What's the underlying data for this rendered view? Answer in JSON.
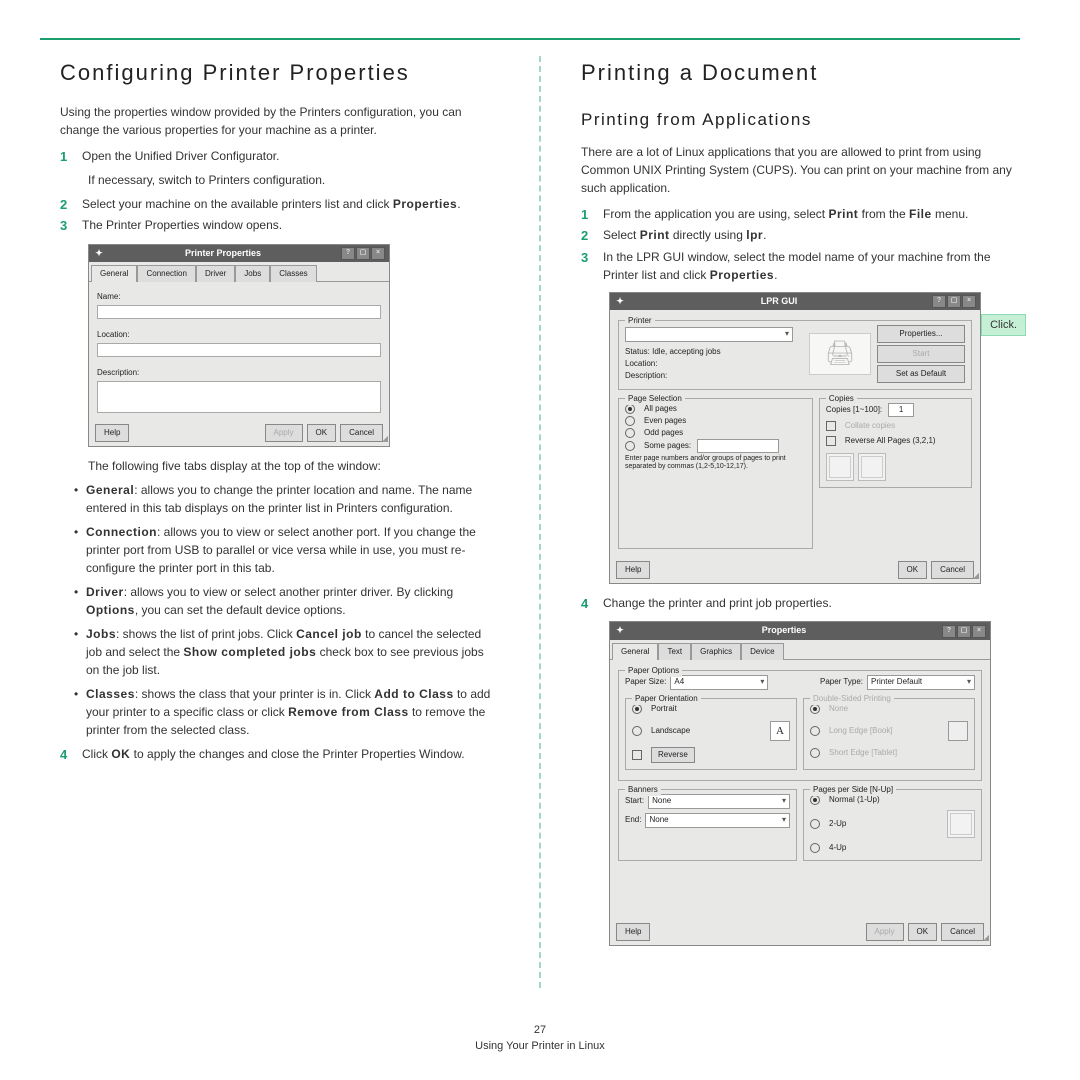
{
  "left": {
    "heading": "Configuring Printer Properties",
    "intro": "Using the properties window provided by the Printers configuration, you can change the various properties for your machine as a printer.",
    "step1": "Open the Unified Driver Configurator.",
    "step1_note": "If necessary, switch to Printers configuration.",
    "step2_a": "Select your machine on the available printers list and click ",
    "step2_b": "Properties",
    "step2_c": ".",
    "step3": "The Printer Properties window opens.",
    "tabs_intro": "The following five tabs display at the top of the window:",
    "b1_t": "General",
    "b1": ": allows you to change the printer location and name. The name entered in this tab displays on the printer list in Printers configuration.",
    "b2_t": "Connection",
    "b2": ": allows you to view or select another port. If you change the printer port from USB to parallel or vice versa while in use, you must re-configure the printer port in this tab.",
    "b3_t": "Driver",
    "b3_a": ": allows you to view or select another printer driver. By clicking ",
    "b3_b": "Options",
    "b3_c": ", you can set the default device options.",
    "b4_t": "Jobs",
    "b4_a": ": shows the list of print jobs. Click ",
    "b4_b": "Cancel job",
    "b4_c": " to cancel the selected job and select the ",
    "b4_d": "Show completed jobs",
    "b4_e": " check box to see previous jobs on the job list.",
    "b5_t": "Classes",
    "b5_a": ": shows the class that your printer is in. Click ",
    "b5_b": "Add to Class",
    "b5_c": " to add your printer to a specific class or click ",
    "b5_d": "Remove from Class",
    "b5_e": " to remove the printer from the selected class.",
    "step4_a": "Click ",
    "step4_b": "OK",
    "step4_c": " to apply the changes and close the Printer Properties Window."
  },
  "right": {
    "heading": "Printing a Document",
    "subheading": "Printing from Applications",
    "intro": "There are a lot of Linux applications that you are allowed to print from using Common UNIX Printing System (CUPS). You can print on your machine from any such application.",
    "s1_a": "From the application you are using, select ",
    "s1_b": "Print",
    "s1_c": " from the ",
    "s1_d": "File",
    "s1_e": " menu.",
    "s2_a": "Select ",
    "s2_b": "Print",
    "s2_c": " directly using ",
    "s2_d": "lpr",
    "s2_e": ".",
    "s3_a": "In the LPR GUI window, select the model name of your machine from the Printer list and click ",
    "s3_b": "Properties",
    "s3_c": ".",
    "callout": "Click.",
    "s4": "Change the printer and print job properties."
  },
  "dlg1": {
    "title": "Printer Properties",
    "tabs": [
      "General",
      "Connection",
      "Driver",
      "Jobs",
      "Classes"
    ],
    "lbl_name": "Name:",
    "lbl_loc": "Location:",
    "lbl_desc": "Description:",
    "help": "Help",
    "apply": "Apply",
    "ok": "OK",
    "cancel": "Cancel"
  },
  "dlg2": {
    "title": "LPR GUI",
    "grp_printer": "Printer",
    "status": "Status: Idle, accepting jobs",
    "loc": "Location:",
    "desc": "Description:",
    "btn_props": "Properties...",
    "btn_start": "Start",
    "btn_setdef": "Set as Default",
    "grp_pagesel": "Page Selection",
    "allp": "All pages",
    "evenp": "Even pages",
    "oddp": "Odd pages",
    "somep": "Some pages:",
    "somep_hint": "Enter page numbers and/or groups of pages to print separated by commas (1,2-5,10-12,17).",
    "grp_copies": "Copies",
    "copieslbl": "Copies [1~100]:",
    "collate": "Collate copies",
    "reverse": "Reverse All Pages (3,2,1)",
    "help": "Help",
    "ok": "OK",
    "cancel": "Cancel"
  },
  "dlg3": {
    "title": "Properties",
    "tabs": [
      "General",
      "Text",
      "Graphics",
      "Device"
    ],
    "grp_po": "Paper Options",
    "psize": "Paper Size:",
    "psize_v": "A4",
    "ptype": "Paper Type:",
    "ptype_v": "Printer Default",
    "grp_orient": "Paper Orientation",
    "portrait": "Portrait",
    "landscape": "Landscape",
    "reverse": "Reverse",
    "grp_dsp": "Double-Sided Printing",
    "dsp1": "None",
    "dsp2": "Long Edge [Book]",
    "dsp3": "Short Edge [Tablet]",
    "grp_ban": "Banners",
    "bstart": "Start:",
    "bend": "End:",
    "bnone": "None",
    "grp_nup": "Pages per Side [N-Up]",
    "n1": "Normal (1-Up)",
    "n2": "2-Up",
    "n4": "4-Up",
    "help": "Help",
    "apply": "Apply",
    "ok": "OK",
    "cancel": "Cancel"
  },
  "footer": {
    "page": "27",
    "section": "Using Your Printer in Linux"
  }
}
